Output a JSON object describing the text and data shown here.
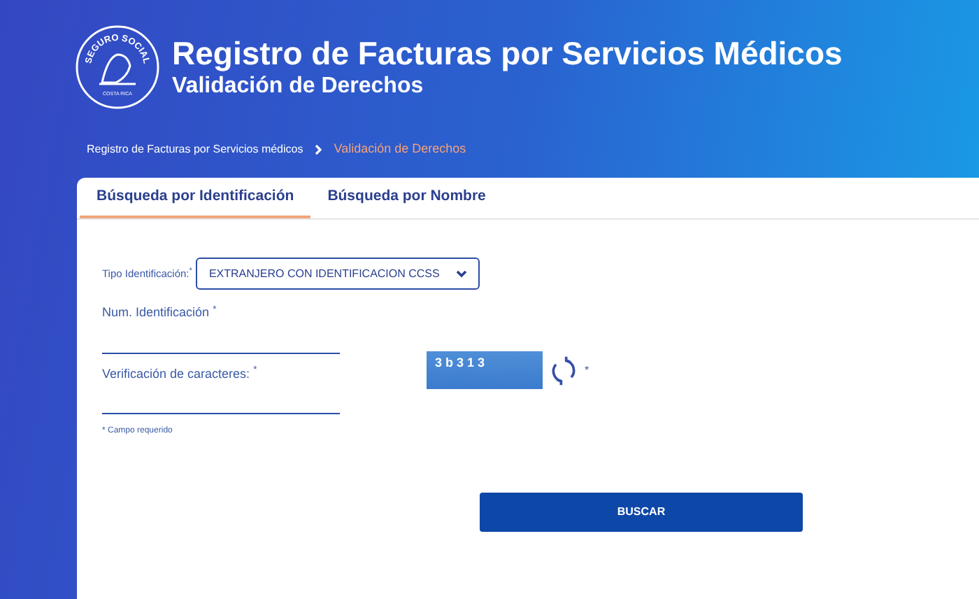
{
  "header": {
    "logo_text": "SEGURO SOCIAL",
    "logo_subtext": "COSTA RICA",
    "title": "Registro de Facturas por Servicios Médicos",
    "subtitle": "Validación de Derechos"
  },
  "breadcrumb": [
    {
      "label": "Registro de Facturas por Servicios médicos",
      "current": false
    },
    {
      "label": "Validación de Derechos",
      "current": true
    }
  ],
  "tabs": [
    {
      "label": "Búsqueda por Identificación",
      "selected": true
    },
    {
      "label": "Búsqueda por Nombre",
      "selected": false
    }
  ],
  "form": {
    "id_type": {
      "label": "Tipo Identificación:",
      "required_mark": "*",
      "value": "EXTRANJERO CON IDENTIFICACION CCSS"
    },
    "id_number": {
      "label": "Num. Identificación",
      "required_mark": "*"
    },
    "verification": {
      "label": "Verificación de caracteres:",
      "required_mark": "*",
      "captcha": "3 b 3 1 3",
      "captcha_mark": "*"
    },
    "required_note": "* Campo requerido",
    "submit": "BUSCAR"
  }
}
